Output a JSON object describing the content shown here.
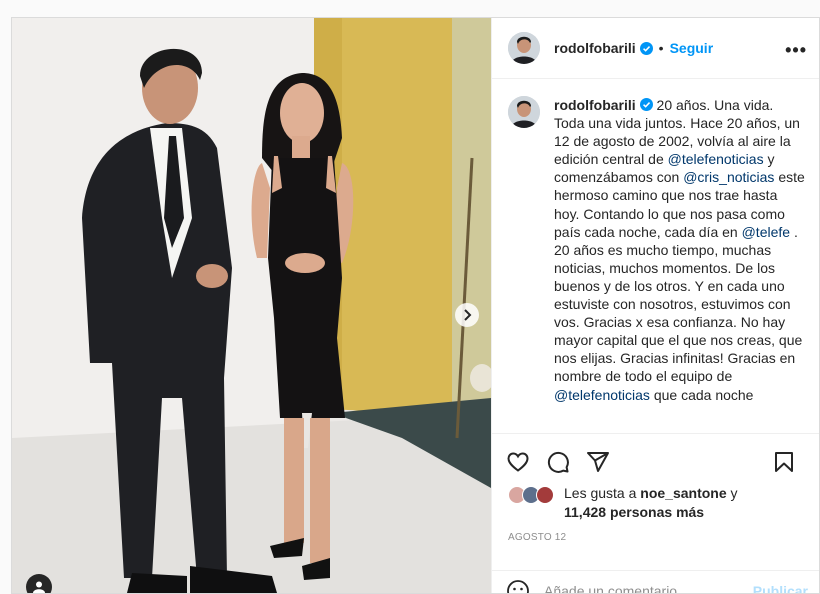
{
  "post": {
    "username": "rodolfobarili",
    "follow_label": "Seguir",
    "header_dot": "•",
    "more_label": "•••",
    "caption": {
      "username": "rodolfobarili",
      "part1": " 20 años. Una vida. Toda una vida juntos. Hace 20 años, un 12 de agosto de 2002, volvía al aire la edición central de ",
      "mention1": "@telefenoticias",
      "part2": " y comenzábamos con ",
      "mention2": "@cris_noticias",
      "part3": " este hermoso camino que nos trae hasta hoy. Contando lo que nos pasa como país cada noche, cada día en ",
      "mention3": "@telefe",
      "part4": " . 20 años es mucho tiempo, muchas noticias, muchos momentos. De los buenos y de los otros. Y en cada uno estuviste con nosotros, estuvimos con vos. Gracias x esa confianza. No hay mayor capital que el que nos creas, que nos elijas. Gracias infinitas! Gracias en nombre de todo el equipo de ",
      "mention4": "@telefenoticias",
      "part5": " que cada noche"
    },
    "likes": {
      "prefix": "Les gusta a ",
      "first_liker": "noe_santone",
      "conj": " y",
      "others": "11,428 personas más"
    },
    "date": "AGOSTO 12",
    "comment": {
      "placeholder": "Añade un comentario...",
      "post_label": "Publicar"
    }
  },
  "icons": [
    "verified-badge-icon",
    "more-options-icon",
    "heart-icon",
    "comment-icon",
    "share-icon",
    "bookmark-icon",
    "emoji-icon",
    "chevron-right-icon",
    "user-tag-icon"
  ],
  "colors": {
    "accent": "#0095f6",
    "post_disabled": "#b2dffc",
    "mention": "#00376b",
    "muted": "#8e8e8e"
  }
}
